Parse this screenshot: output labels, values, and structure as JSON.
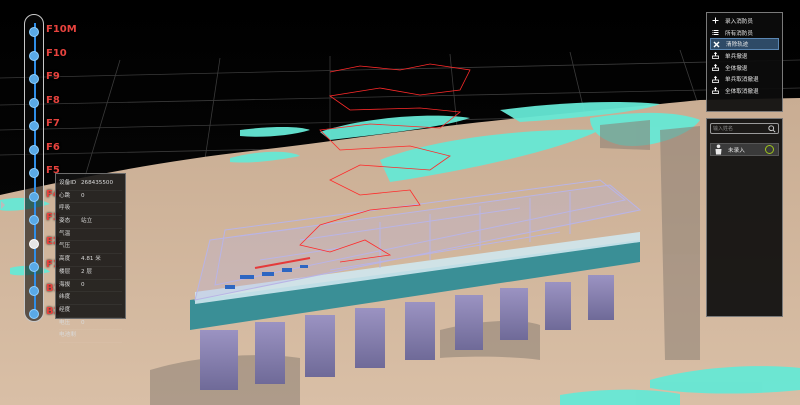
{
  "floor_slider": {
    "floors": [
      "F10M",
      "F10",
      "F9",
      "F8",
      "F7",
      "F6",
      "F5",
      "F4",
      "F3",
      "E2",
      "F1",
      "B1",
      "B2"
    ],
    "selected": "E2",
    "accent_color": "#2f8ee8",
    "label_color": "#e8433e"
  },
  "info_panel": {
    "rows": [
      {
        "key": "设备ID",
        "value": "268435500"
      },
      {
        "key": "心跳",
        "value": "0"
      },
      {
        "key": "呼吸",
        "value": ""
      },
      {
        "key": "姿态",
        "value": "站立"
      },
      {
        "key": "气温",
        "value": ""
      },
      {
        "key": "气压",
        "value": ""
      },
      {
        "key": "高度",
        "value": "4.81 米"
      },
      {
        "key": "楼层",
        "value": "2 层"
      },
      {
        "key": "海拔",
        "value": "0"
      },
      {
        "key": "纬度",
        "value": ""
      },
      {
        "key": "经度",
        "value": ""
      },
      {
        "key": "电压",
        "value": "0"
      },
      {
        "key": "电池剩",
        "value": ""
      }
    ]
  },
  "menu": {
    "items": [
      {
        "label": "录入消防员",
        "icon": "plus-icon",
        "active": false
      },
      {
        "label": "所有消防员",
        "icon": "list-icon",
        "active": false
      },
      {
        "label": "清除轨迹",
        "icon": "close-icon",
        "active": true
      },
      {
        "label": "单兵撤退",
        "icon": "exit-icon",
        "active": false
      },
      {
        "label": "全体撤退",
        "icon": "exit-icon",
        "active": false
      },
      {
        "label": "单兵取消撤退",
        "icon": "exit-icon",
        "active": false
      },
      {
        "label": "全体取消撤退",
        "icon": "exit-icon",
        "active": false
      }
    ]
  },
  "person_panel": {
    "search_placeholder": "输入姓名",
    "person": {
      "status": "未录入",
      "avatar_icon": "person-icon",
      "status_color": "#9fc51b"
    }
  },
  "scene": {
    "terrain_color": "#d2b79c",
    "water_color": "#66e8d5",
    "trajectory_color": "#ff2a2a"
  }
}
